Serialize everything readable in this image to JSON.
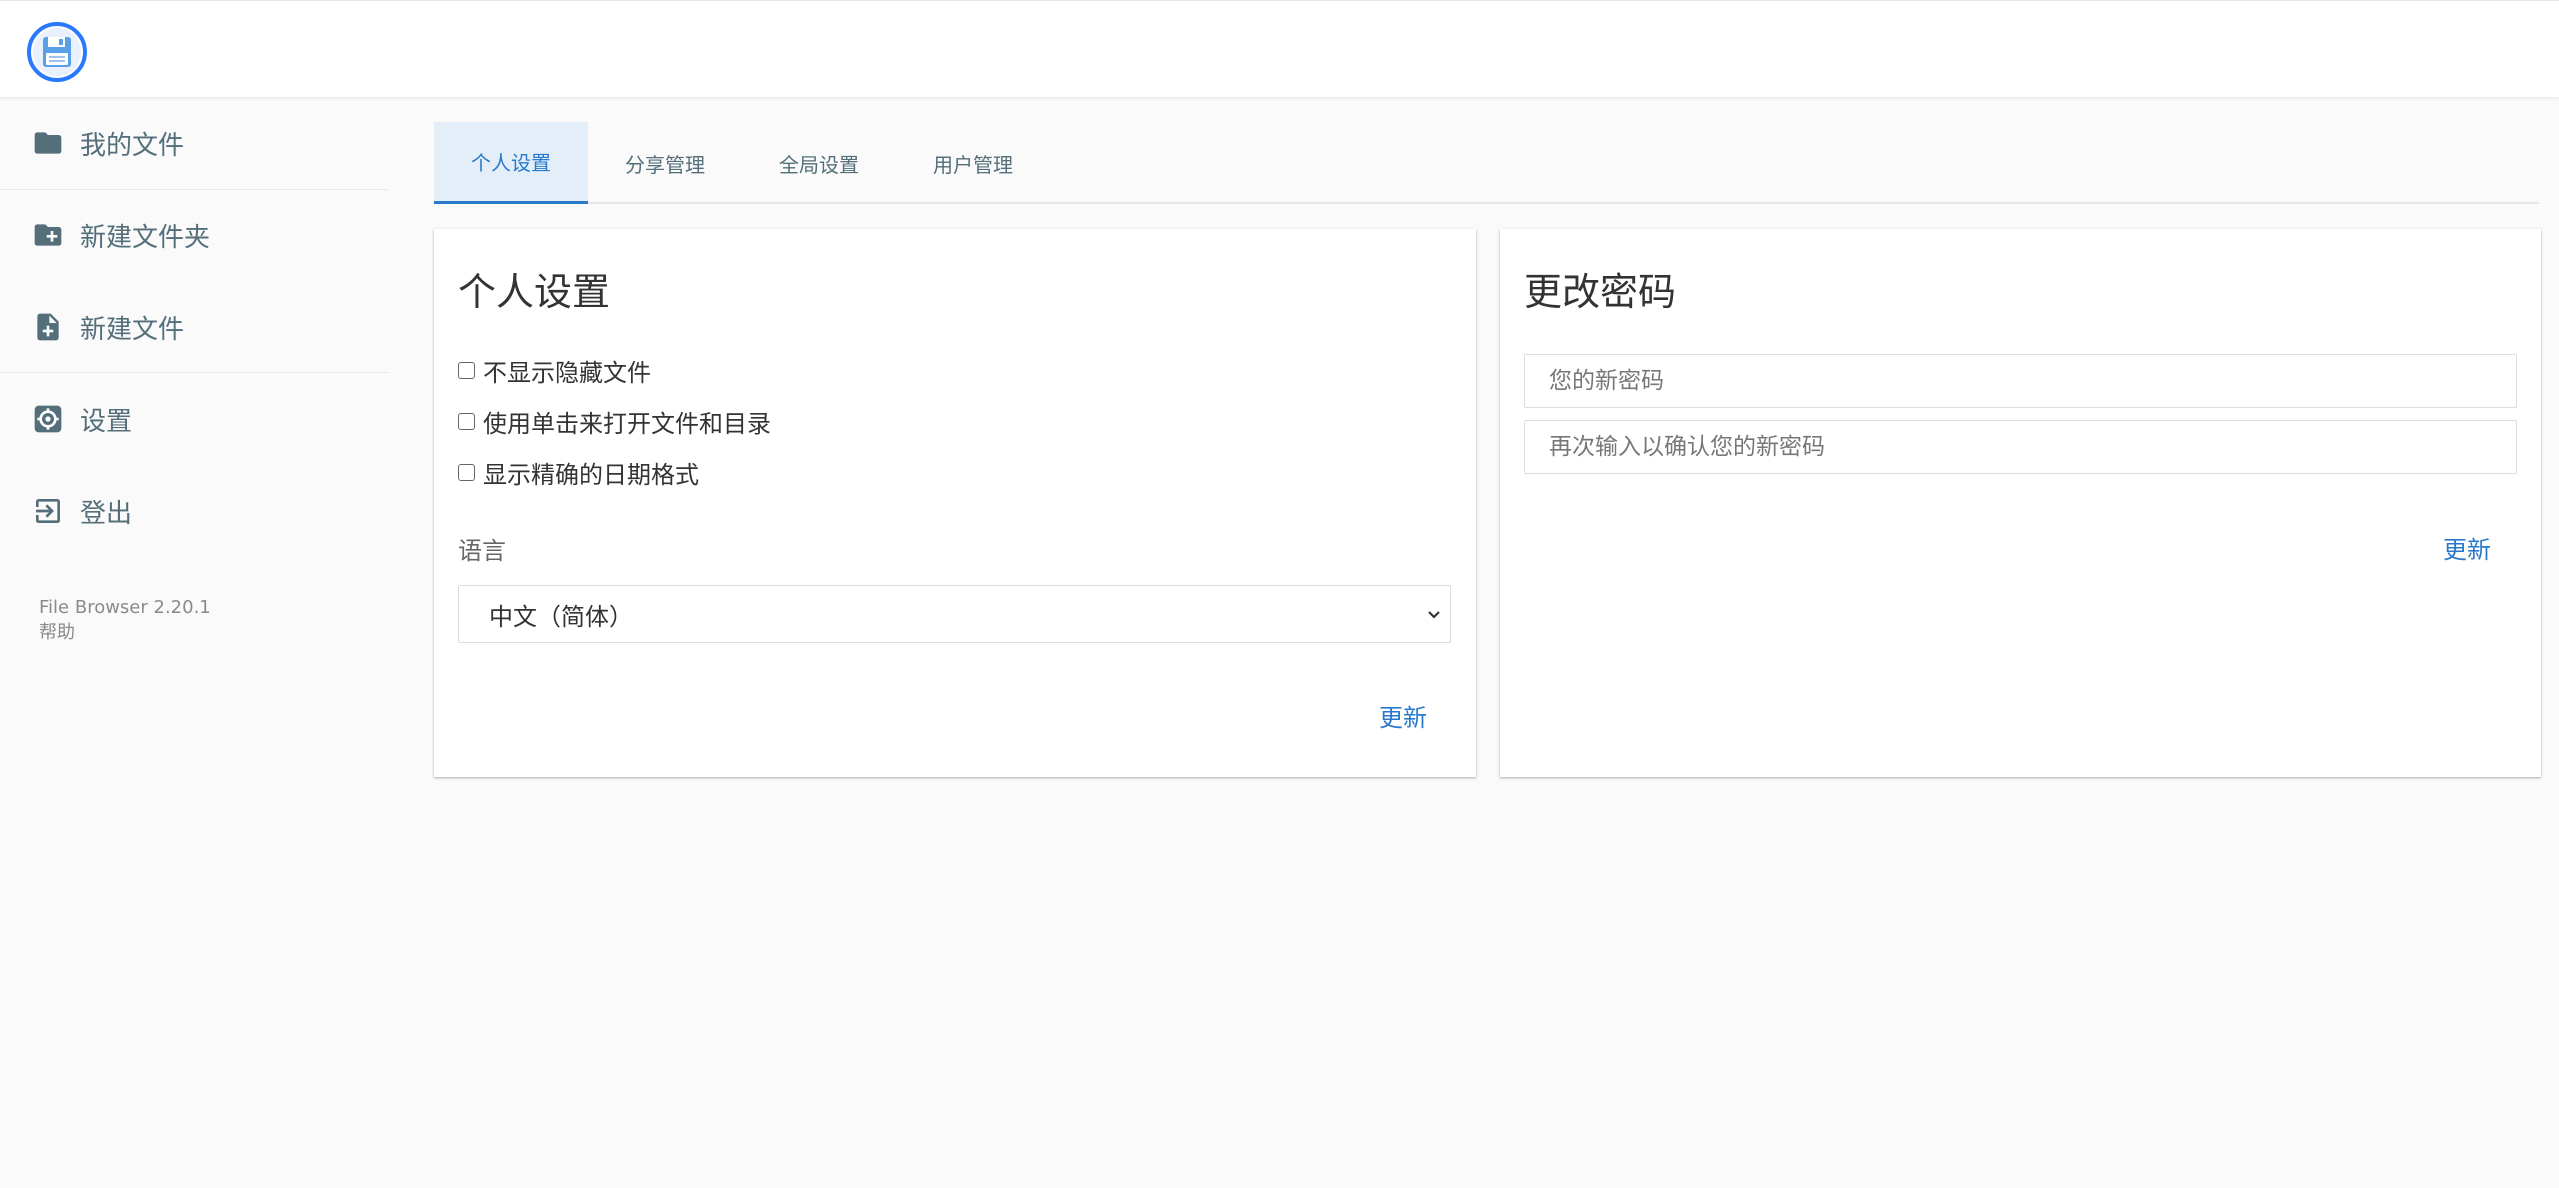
{
  "header": {
    "logo_icon": "floppy-disk-icon"
  },
  "sidebar": {
    "items": [
      {
        "label": "我的文件",
        "icon": "folder-icon"
      },
      {
        "label": "新建文件夹",
        "icon": "folder-plus-icon"
      },
      {
        "label": "新建文件",
        "icon": "file-plus-icon"
      },
      {
        "label": "设置",
        "icon": "gear-icon"
      },
      {
        "label": "登出",
        "icon": "logout-icon"
      }
    ],
    "credits": {
      "version": "File Browser 2.20.1",
      "help": "帮助"
    }
  },
  "tabs": [
    {
      "label": "个人设置",
      "active": true
    },
    {
      "label": "分享管理",
      "active": false
    },
    {
      "label": "全局设置",
      "active": false
    },
    {
      "label": "用户管理",
      "active": false
    }
  ],
  "profile_card": {
    "title": "个人设置",
    "options": [
      {
        "label": "不显示隐藏文件",
        "checked": false
      },
      {
        "label": "使用单击来打开文件和目录",
        "checked": false
      },
      {
        "label": "显示精确的日期格式",
        "checked": false
      }
    ],
    "language_label": "语言",
    "language_value": "中文（简体）",
    "submit_label": "更新"
  },
  "password_card": {
    "title": "更改密码",
    "new_password_placeholder": "您的新密码",
    "confirm_password_placeholder": "再次输入以确认您的新密码",
    "submit_label": "更新"
  },
  "colors": {
    "accent": "#2979cc",
    "sidebar_text": "#546e7a",
    "background": "#fafafa"
  }
}
